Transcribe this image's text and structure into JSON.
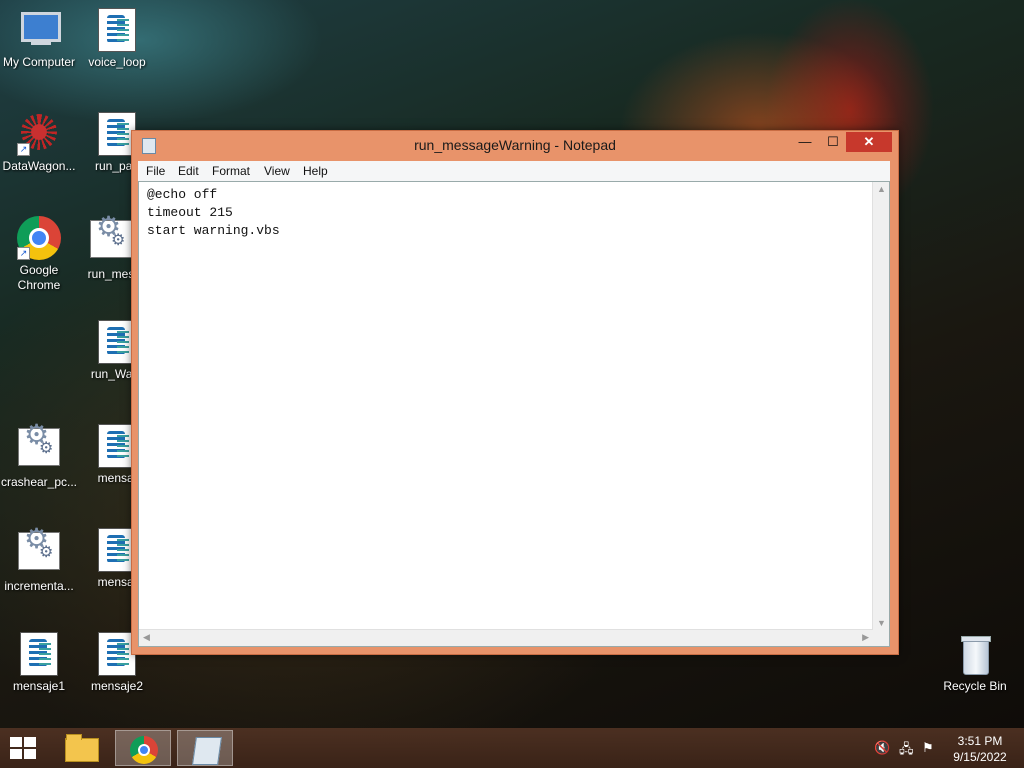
{
  "desktop": {
    "icons": [
      {
        "label": "My Computer",
        "icon": "computer-icon"
      },
      {
        "label": "voice_loop",
        "icon": "script-icon"
      },
      {
        "label": "DataWagon...",
        "icon": "datawagon-icon"
      },
      {
        "label": "run_pag",
        "icon": "script-icon"
      },
      {
        "label": "Google Chrome",
        "icon": "chrome-icon"
      },
      {
        "label": "run_mes",
        "icon": "settings-file-icon"
      },
      {
        "label": "run_Warn",
        "icon": "script-icon"
      },
      {
        "label": "crashear_pc...",
        "icon": "settings-file-icon"
      },
      {
        "label": "mensaj",
        "icon": "script-icon"
      },
      {
        "label": "incrementa...",
        "icon": "settings-file-icon"
      },
      {
        "label": "mensaj",
        "icon": "script-icon"
      },
      {
        "label": "mensaje1",
        "icon": "script-icon"
      },
      {
        "label": "mensaje2",
        "icon": "script-icon"
      },
      {
        "label": "Recycle Bin",
        "icon": "recycle-bin-icon"
      }
    ]
  },
  "window": {
    "title": "run_messageWarning - Notepad",
    "menu": [
      "File",
      "Edit",
      "Format",
      "View",
      "Help"
    ],
    "content": "@echo off\ntimeout 215\nstart warning.vbs",
    "controls": {
      "minimize": "—",
      "maximize": "☐",
      "close": "✕"
    }
  },
  "taskbar": {
    "clock_time": "3:51 PM",
    "clock_date": "9/15/2022"
  },
  "colors": {
    "window_frame": "#e8936a",
    "close_button": "#c7382c",
    "taskbar": "#4e2f20"
  }
}
